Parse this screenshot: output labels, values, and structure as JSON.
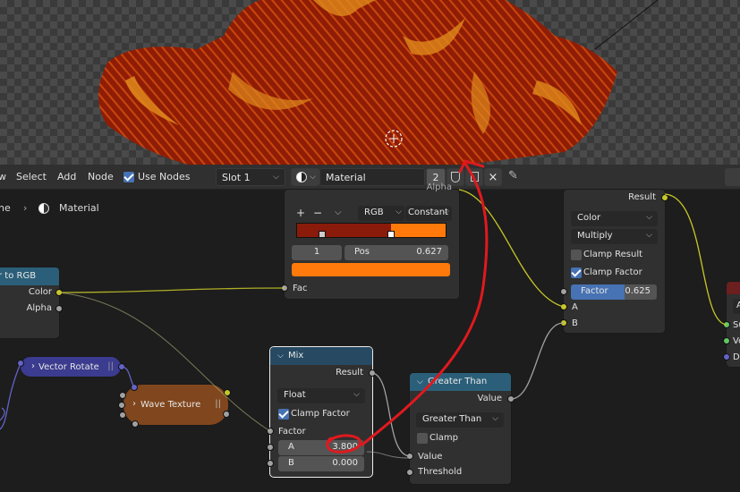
{
  "header": {
    "menu_view": "w",
    "menu_select": "Select",
    "menu_add": "Add",
    "menu_node": "Node",
    "use_nodes_label": "Use Nodes",
    "slot": "Slot 1",
    "material_name": "Material",
    "user_count": "2"
  },
  "breadcrumb": {
    "object": "ne",
    "material": "Material"
  },
  "colorramp": {
    "alpha_label": "Alpha",
    "add": "+",
    "remove": "−",
    "color_mode": "RGB",
    "interpolation": "Constant",
    "index": "1",
    "pos_label": "Pos",
    "pos_value": "0.627",
    "fac_label": "Fac",
    "active_color": "#ff7a0a",
    "left_color": "#8a1a0a"
  },
  "separate": {
    "title": "r to RGB",
    "color_label": "Color",
    "alpha_label": "Alpha"
  },
  "vector_rotate": {
    "title": "Vector Rotate"
  },
  "wave_texture": {
    "title": "Wave Texture"
  },
  "mix_float": {
    "title": "Mix",
    "result_label": "Result",
    "data_type": "Float",
    "clamp_label": "Clamp Factor",
    "factor_label": "Factor",
    "a_label": "A",
    "a_value": "3.800",
    "b_label": "B",
    "b_value": "0.000"
  },
  "greater_than": {
    "title": "Greater Than",
    "value_out_label": "Value",
    "operation": "Greater Than",
    "clamp_label": "Clamp",
    "value_in_label": "Value",
    "threshold_label": "Threshold"
  },
  "mix_color": {
    "result_label": "Result",
    "data_type": "Color",
    "blend": "Multiply",
    "clamp_result_label": "Clamp Result",
    "clamp_factor_label": "Clamp Factor",
    "factor_label": "Factor",
    "factor_value": "0.625",
    "factor_fraction": 0.625,
    "a_label": "A",
    "b_label": "B"
  },
  "output": {
    "field_a": "A",
    "surface": "Su",
    "volume": "Vo",
    "displacement": "Di"
  },
  "colors": {
    "header_bg": "#303030",
    "node_bg": "#303030",
    "mix_header": "#274a62",
    "converter_header": "#2b5f79",
    "texture_node": "#80461d",
    "vector_node": "#3b3b8f",
    "socket_float": "#a1a1a1",
    "socket_color": "#c7c729",
    "socket_vector": "#6363c7",
    "socket_shader": "#63c763",
    "accent_blue": "#4772b3",
    "annotation_red": "#e0191e"
  }
}
